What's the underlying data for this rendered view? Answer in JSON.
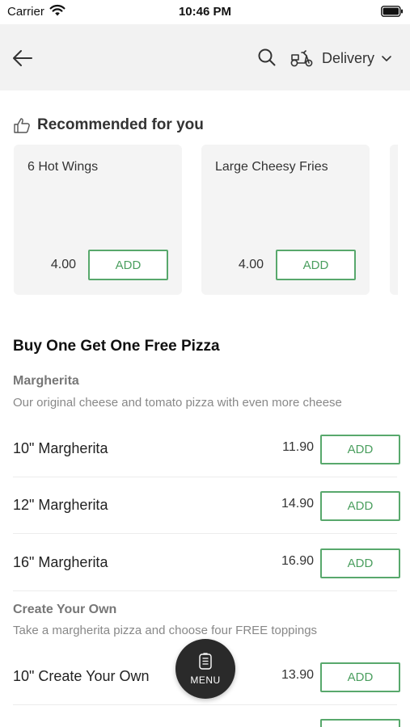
{
  "status_bar": {
    "carrier": "Carrier",
    "time": "10:46 PM"
  },
  "header": {
    "delivery_label": "Delivery"
  },
  "recommended": {
    "title": "Recommended for you",
    "items": [
      {
        "name": "6 Hot Wings",
        "price": "4.00",
        "button": "ADD"
      },
      {
        "name": "Large Cheesy Fries",
        "price": "4.00",
        "button": "ADD"
      }
    ]
  },
  "section": {
    "title": "Buy One Get One Free Pizza",
    "groups": [
      {
        "name": "Margherita",
        "description": "Our original cheese and tomato pizza with even more cheese",
        "items": [
          {
            "name": "10\" Margherita",
            "price": "11.90",
            "button": "ADD"
          },
          {
            "name": "12\" Margherita",
            "price": "14.90",
            "button": "ADD"
          },
          {
            "name": "16\" Margherita",
            "price": "16.90",
            "button": "ADD"
          }
        ]
      },
      {
        "name": "Create Your Own",
        "description": "Take a margherita pizza and choose four FREE toppings",
        "items": [
          {
            "name": "10\" Create Your Own",
            "price": "13.90",
            "button": "ADD"
          }
        ]
      }
    ]
  },
  "menu_fab": {
    "label": "MENU"
  },
  "colors": {
    "accent": "#58a86c",
    "header_bg": "#f2f2f2",
    "card_bg": "#f4f4f4",
    "fab_bg": "#2a2a2a"
  },
  "icons": [
    "wifi-icon",
    "battery-icon",
    "back-arrow-icon",
    "search-icon",
    "scooter-icon",
    "chevron-down-icon",
    "thumbs-up-icon",
    "menu-icon"
  ]
}
